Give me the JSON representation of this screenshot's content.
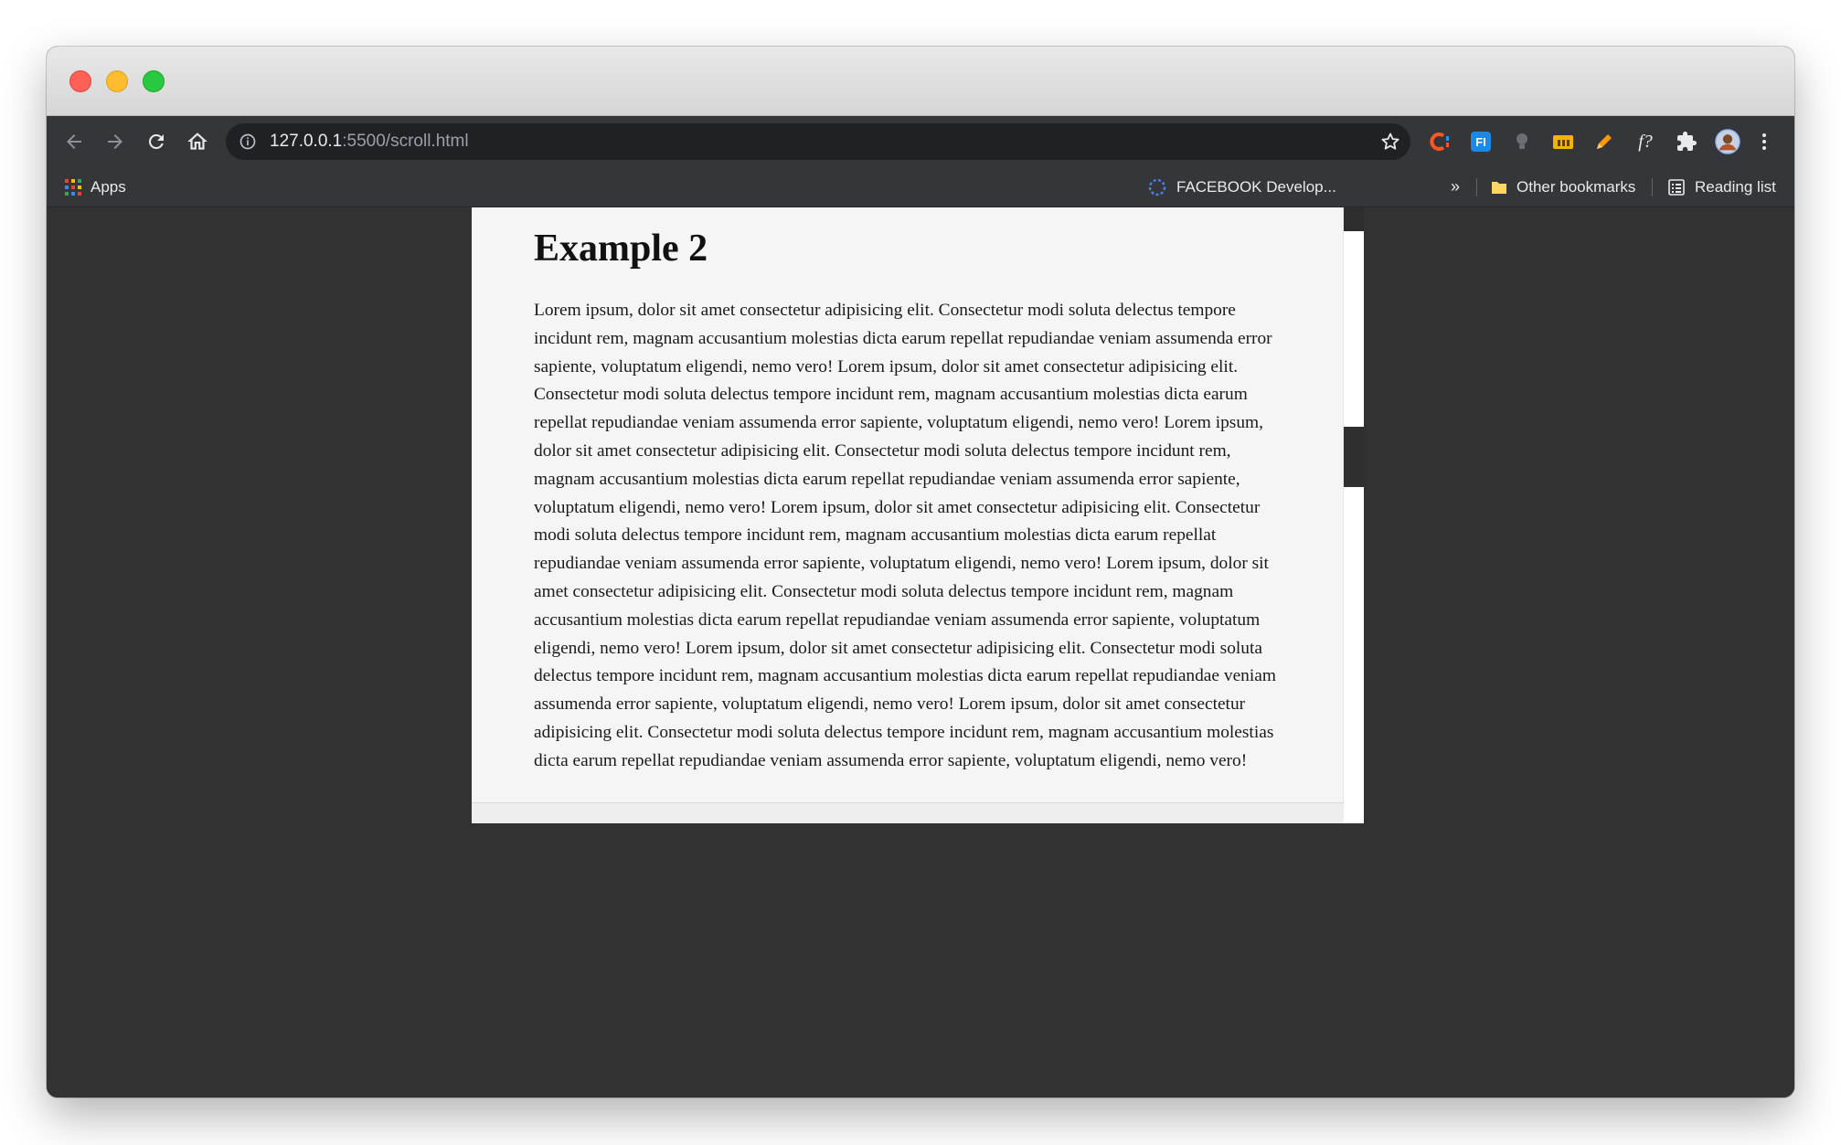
{
  "browser": {
    "url_host": "127.0.0.1",
    "url_rest": ":5500/scroll.html",
    "colors": {
      "toolbar": "#35363a",
      "omnibox": "#202124",
      "page_background": "#323233",
      "box_background": "#f5f5f5"
    }
  },
  "bookmarks": {
    "apps_label": "Apps",
    "facebook_label": "FACEBOOK Develop...",
    "more_label": "»",
    "other_label": "Other bookmarks",
    "reading_label": "Reading list"
  },
  "extensions": [
    {
      "icon": "c-extension-icon"
    },
    {
      "icon": "fi-extension-icon",
      "label": "FI"
    },
    {
      "icon": "grey-extension-icon"
    },
    {
      "icon": "folder-extension-icon"
    },
    {
      "icon": "pencil-extension-icon"
    },
    {
      "icon": "formula-extension-icon",
      "label": "f?"
    },
    {
      "icon": "puzzle-icon"
    },
    {
      "icon": "profile-avatar"
    },
    {
      "icon": "menu-icon"
    }
  ],
  "page": {
    "heading": "Example 2",
    "paragraph": "Lorem ipsum, dolor sit amet consectetur adipisicing elit. Consectetur modi soluta delectus tempore incidunt rem, magnam accusantium molestias dicta earum repellat repudiandae veniam assumenda error sapiente, voluptatum eligendi, nemo vero! Lorem ipsum, dolor sit amet consectetur adipisicing elit. Consectetur modi soluta delectus tempore incidunt rem, magnam accusantium molestias dicta earum repellat repudiandae veniam assumenda error sapiente, voluptatum eligendi, nemo vero! Lorem ipsum, dolor sit amet consectetur adipisicing elit. Consectetur modi soluta delectus tempore incidunt rem, magnam accusantium molestias dicta earum repellat repudiandae veniam assumenda error sapiente, voluptatum eligendi, nemo vero! Lorem ipsum, dolor sit amet consectetur adipisicing elit. Consectetur modi soluta delectus tempore incidunt rem, magnam accusantium molestias dicta earum repellat repudiandae veniam assumenda error sapiente, voluptatum eligendi, nemo vero! Lorem ipsum, dolor sit amet consectetur adipisicing elit. Consectetur modi soluta delectus tempore incidunt rem, magnam accusantium molestias dicta earum repellat repudiandae veniam assumenda error sapiente, voluptatum eligendi, nemo vero! Lorem ipsum, dolor sit amet consectetur adipisicing elit. Consectetur modi soluta delectus tempore incidunt rem, magnam accusantium molestias dicta earum repellat repudiandae veniam assumenda error sapiente, voluptatum eligendi, nemo vero! Lorem ipsum, dolor sit amet consectetur adipisicing elit. Consectetur modi soluta delectus tempore incidunt rem, magnam accusantium molestias dicta earum repellat repudiandae veniam assumenda error sapiente, voluptatum eligendi, nemo vero!"
  }
}
